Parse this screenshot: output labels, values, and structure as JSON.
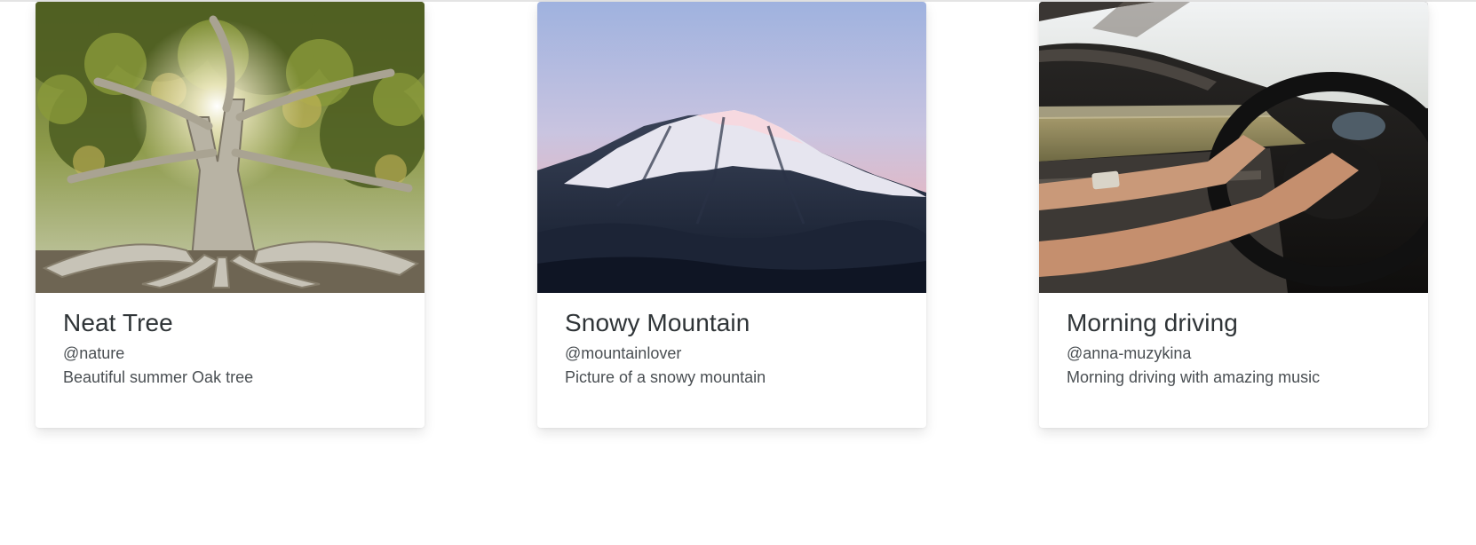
{
  "cards": [
    {
      "title": "Neat Tree",
      "handle": "@nature",
      "description": "Beautiful summer Oak tree",
      "image": "tree-photo"
    },
    {
      "title": "Snowy Mountain",
      "handle": "@mountainlover",
      "description": "Picture of a snowy mountain",
      "image": "mountain-photo"
    },
    {
      "title": "Morning driving",
      "handle": "@anna-muzykina",
      "description": "Morning driving with amazing music",
      "image": "car-driving-photo"
    }
  ]
}
